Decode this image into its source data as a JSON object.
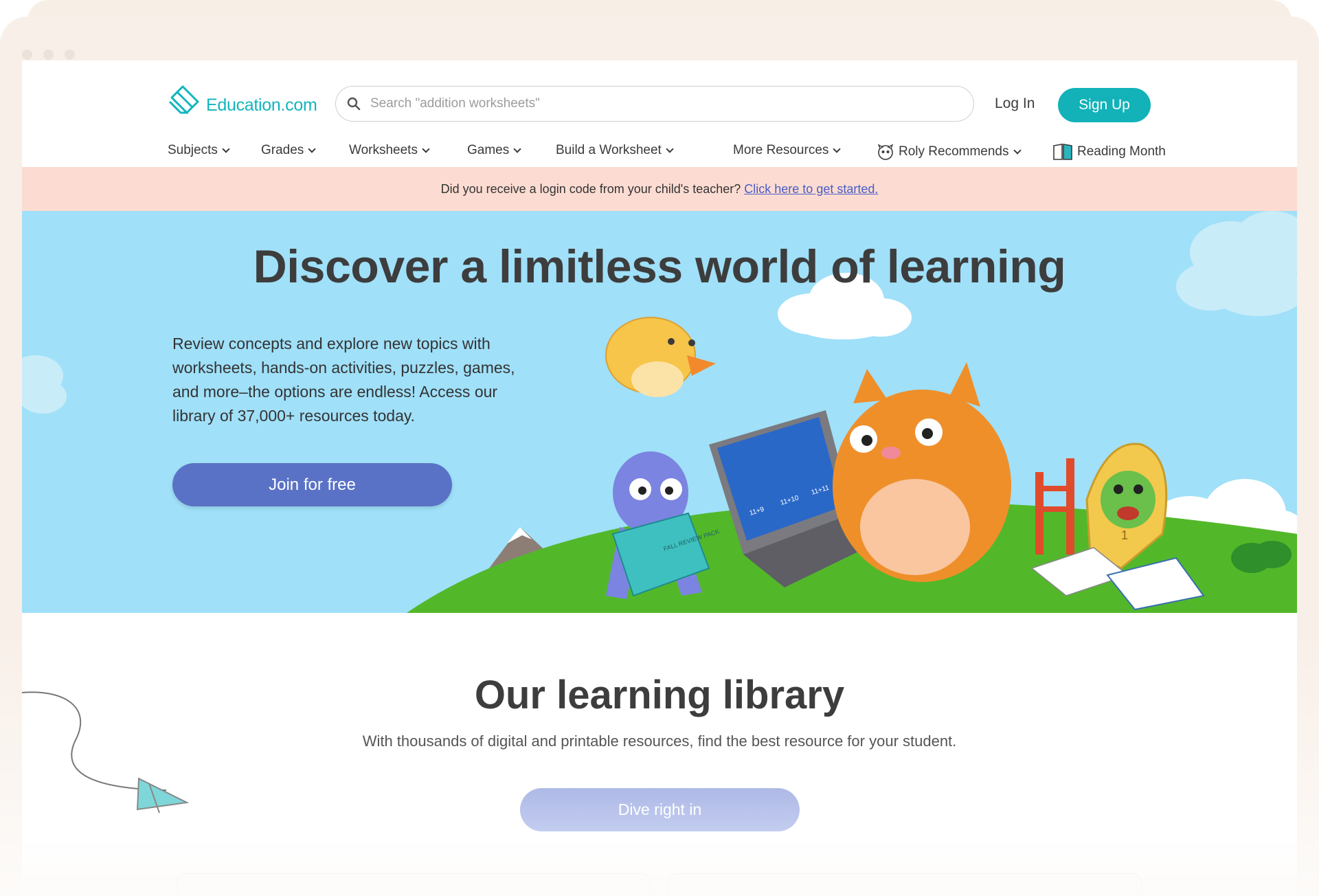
{
  "logo": {
    "text": "Education.com"
  },
  "search": {
    "placeholder": "Search \"addition worksheets\""
  },
  "header": {
    "login": "Log In",
    "signup": "Sign Up"
  },
  "nav": {
    "items": [
      {
        "label": "Subjects"
      },
      {
        "label": "Grades"
      },
      {
        "label": "Worksheets"
      },
      {
        "label": "Games"
      },
      {
        "label": "Build a Worksheet"
      },
      {
        "label": "More Resources"
      },
      {
        "label": "Roly Recommends"
      },
      {
        "label": "Reading Month"
      }
    ]
  },
  "notice": {
    "text": "Did you receive a login code from your child's teacher?",
    "link": "Click here to get started."
  },
  "hero": {
    "title": "Discover a limitless world of learning",
    "description": "Review concepts and explore new topics with worksheets, hands-on activities, puzzles, games, and more–the options are endless! Access our library of 37,000+ resources today.",
    "cta": "Join for free",
    "book_label": "FALL REVIEW PACK",
    "screen_labels": [
      "11+9",
      "11+10",
      "11+11"
    ],
    "badge_number": "1"
  },
  "library": {
    "title": "Our learning library",
    "subtitle": "With thousands of digital and printable resources, find the best resource for your student.",
    "cta": "Dive right in"
  },
  "colors": {
    "brand_teal": "#12b2b8",
    "hero_sky": "#a0e0f9",
    "notice_bg": "#fcdcd2",
    "join_button": "#5a72c6",
    "grass": "#52b82a"
  }
}
